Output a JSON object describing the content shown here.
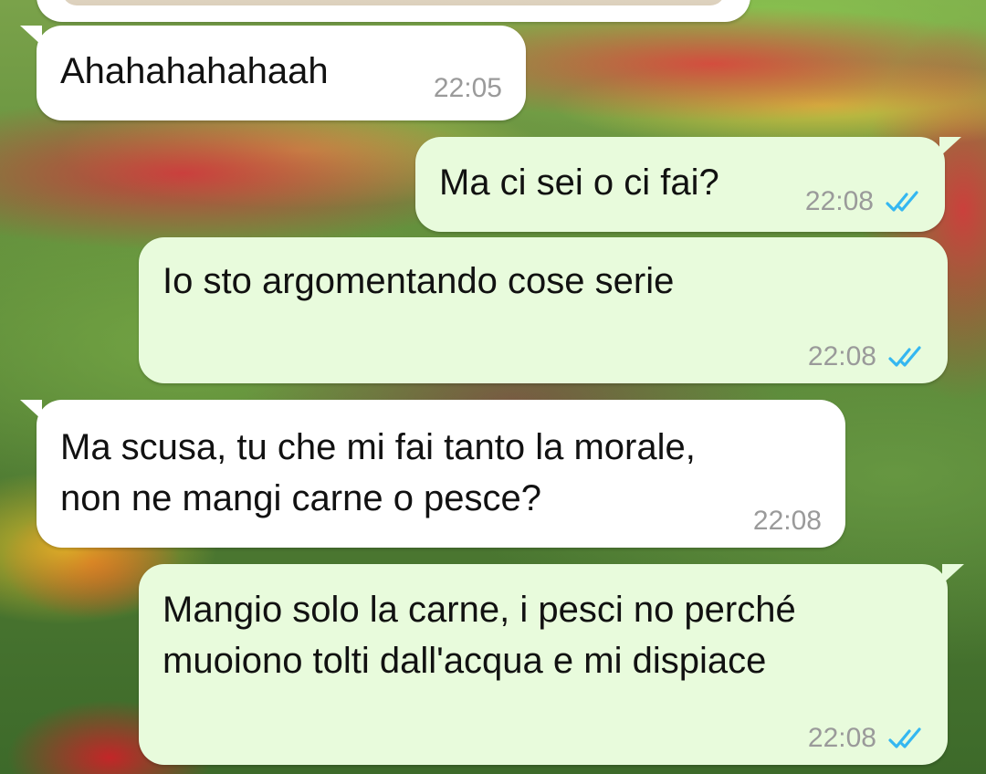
{
  "chat": {
    "messages": [
      {
        "direction": "in",
        "text": "Ahahahahahaah",
        "time": "22:05",
        "read": false
      },
      {
        "direction": "out",
        "text": "Ma ci sei o ci fai?",
        "time": "22:08",
        "read": true
      },
      {
        "direction": "out",
        "text": "Io sto argomentando cose serie",
        "time": "22:08",
        "read": true
      },
      {
        "direction": "in",
        "text": "Ma scusa, tu che mi fai tanto la morale,\nnon ne mangi carne o pesce?",
        "time": "22:08",
        "read": false
      },
      {
        "direction": "out",
        "text": "Mangio solo la carne, i pesci no perché\nmuoiono tolti dall'acqua e mi dispiace",
        "time": "22:08",
        "read": true
      }
    ]
  },
  "colors": {
    "incoming_bubble": "#ffffff",
    "outgoing_bubble": "#e8fbdc",
    "read_receipt": "#34b7f1",
    "timestamp": "#9a9a9a"
  },
  "icons": {
    "read_receipt": "double-check-icon"
  }
}
